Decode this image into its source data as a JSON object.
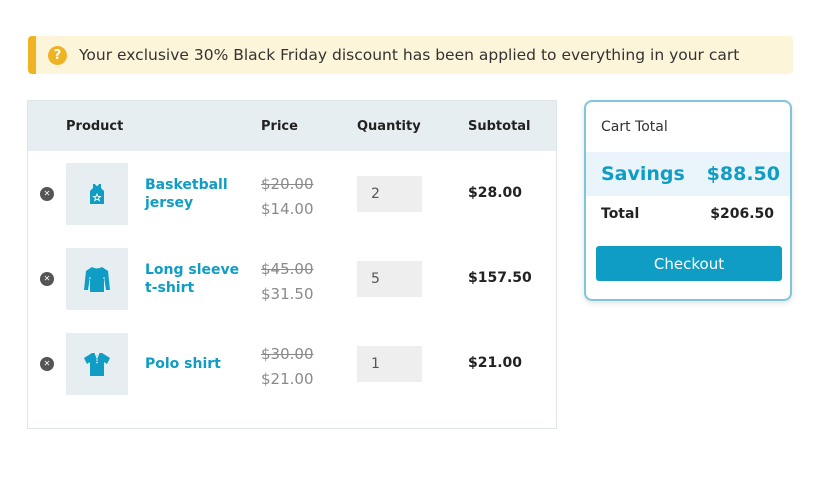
{
  "notice": {
    "message": "Your exclusive 30%  Black Friday discount has been applied to everything in your cart",
    "icon": "question-icon",
    "accent_color": "#f0b323"
  },
  "table": {
    "headers": {
      "product": "Product",
      "price": "Price",
      "quantity": "Quantity",
      "subtotal": "Subtotal"
    },
    "items": [
      {
        "name": "Basketball jersey",
        "old_price": "$20.00",
        "new_price": "$14.00",
        "quantity": "2",
        "subtotal": "$28.00",
        "icon": "jersey-icon"
      },
      {
        "name": "Long sleeve t-shirt",
        "old_price": "$45.00",
        "new_price": "$31.50",
        "quantity": "5",
        "subtotal": "$157.50",
        "icon": "long-sleeve-shirt-icon"
      },
      {
        "name": "Polo shirt",
        "old_price": "$30.00",
        "new_price": "$21.00",
        "quantity": "1",
        "subtotal": "$21.00",
        "icon": "polo-shirt-icon"
      }
    ]
  },
  "totals": {
    "title": "Cart Total",
    "savings_label": "Savings",
    "savings_value": "$88.50",
    "total_label": "Total",
    "total_value": "$206.50",
    "checkout_label": "Checkout"
  },
  "colors": {
    "accent": "#0f9cc5",
    "header_bg": "#e6eef2",
    "notice_bg": "#fdf5d9"
  }
}
